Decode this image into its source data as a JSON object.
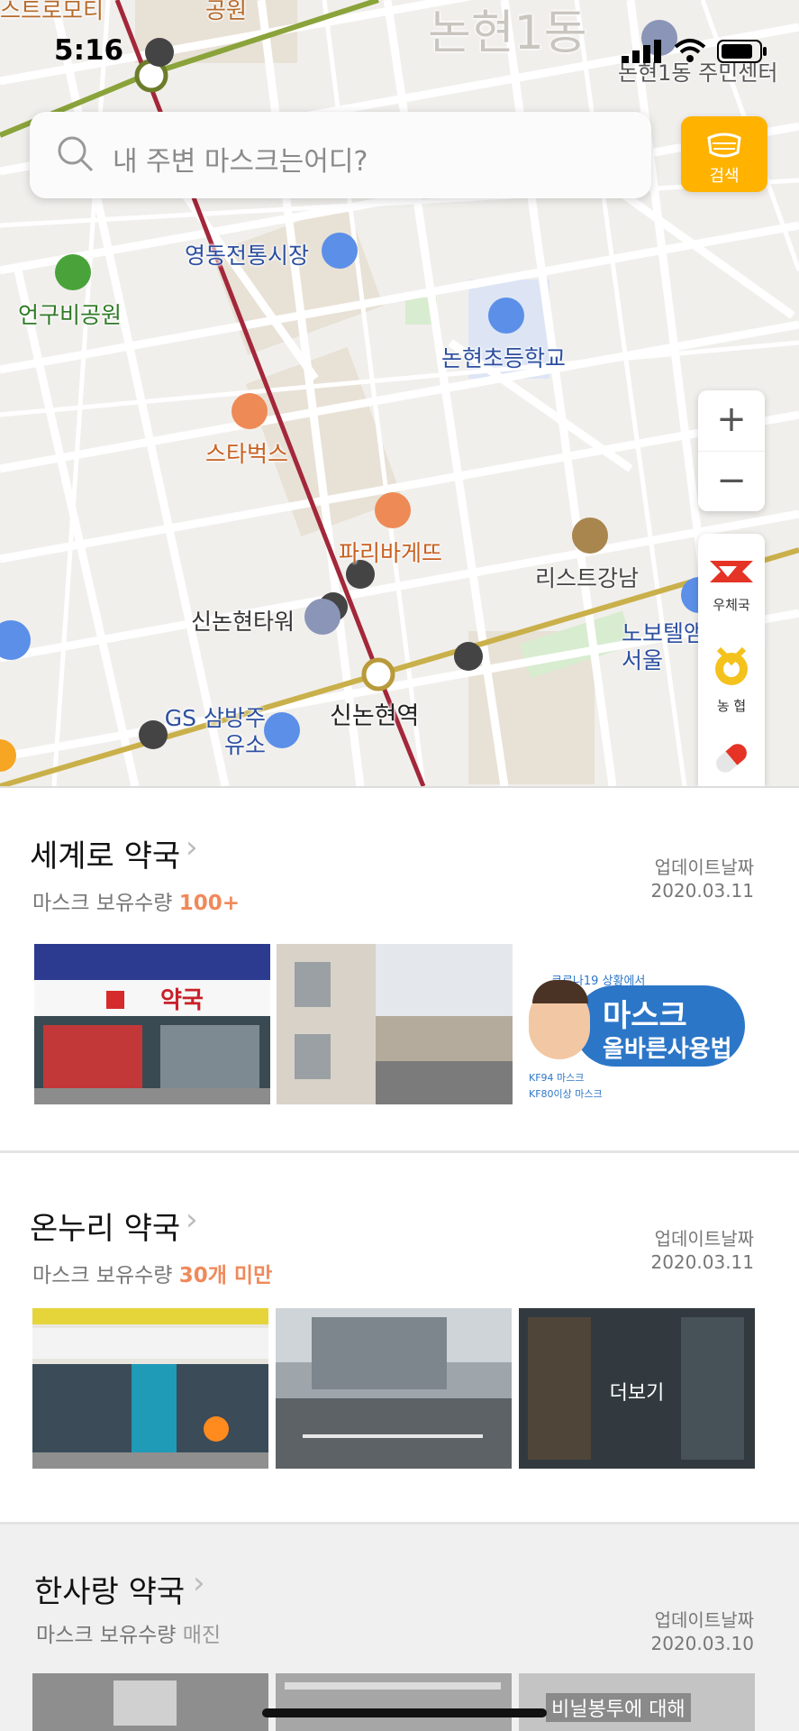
{
  "status_bar": {
    "time": "5:16"
  },
  "search": {
    "placeholder": "내 주변 마스크는어디?",
    "button_label": "검색"
  },
  "map": {
    "area_labels": [
      "논현1동",
      "논현1동 주민센터",
      "공원",
      "스트로모티"
    ],
    "pois": [
      {
        "label": "영동전통시장",
        "color": "#5b8fe8"
      },
      {
        "label": "언구비공원",
        "color": "#49a33a"
      },
      {
        "label": "논현초등학교",
        "color": "#5b8fe8"
      },
      {
        "label": "스타벅스",
        "color": "#ee8a55"
      },
      {
        "label": "파리바게뜨",
        "color": "#ee8a55"
      },
      {
        "label": "리스트강남",
        "color": "#a8864e"
      },
      {
        "label": "신논현타워",
        "color": "#8a95b8"
      },
      {
        "label": "노보텔앰배서더 서울",
        "color": "#5b8fe8"
      },
      {
        "label": "GS 삼방주유소",
        "color": "#5b8fe8"
      },
      {
        "label": "신논현역",
        "color": "#333333"
      }
    ],
    "zoom_in": "+",
    "zoom_out": "−",
    "filters": [
      {
        "label": "우체국",
        "icon": "post-office-icon"
      },
      {
        "label": "농 협",
        "icon": "nonghyup-icon"
      },
      {
        "label": "",
        "icon": "pill-icon"
      }
    ]
  },
  "pharmacies": [
    {
      "name": "세계로 약국",
      "stock_label": "마스크 보유수량",
      "stock_value": "100+",
      "stock_color": "#f0895a",
      "update_label": "업데이트날짜",
      "update_date": "2020.03.11",
      "more_label": ""
    },
    {
      "name": "온누리 약국",
      "stock_label": "마스크 보유수량",
      "stock_value": "30개 미만",
      "stock_color": "#f0895a",
      "update_label": "업데이트날짜",
      "update_date": "2020.03.11",
      "more_label": "더보기"
    },
    {
      "name": "한사랑 약국",
      "stock_label": "마스크 보유수량",
      "stock_value": "매진",
      "stock_color": "#999999",
      "update_label": "업데이트날짜",
      "update_date": "2020.03.10",
      "more_label": ""
    }
  ],
  "photo_texts": {
    "sign": "약국",
    "poster_line1": "마스크",
    "poster_line2": "올바른사용법",
    "poster_kf94": "KF94 마스크",
    "poster_kf80": "KF80이상 마스크",
    "poster_top": "코로나19 상황에서",
    "third_sign": "비닐봉투에 대해"
  },
  "colors": {
    "accent": "#ffb300",
    "stock_orange": "#f0895a",
    "subway_green": "#8aa33a",
    "subway_red": "#a3273a"
  }
}
